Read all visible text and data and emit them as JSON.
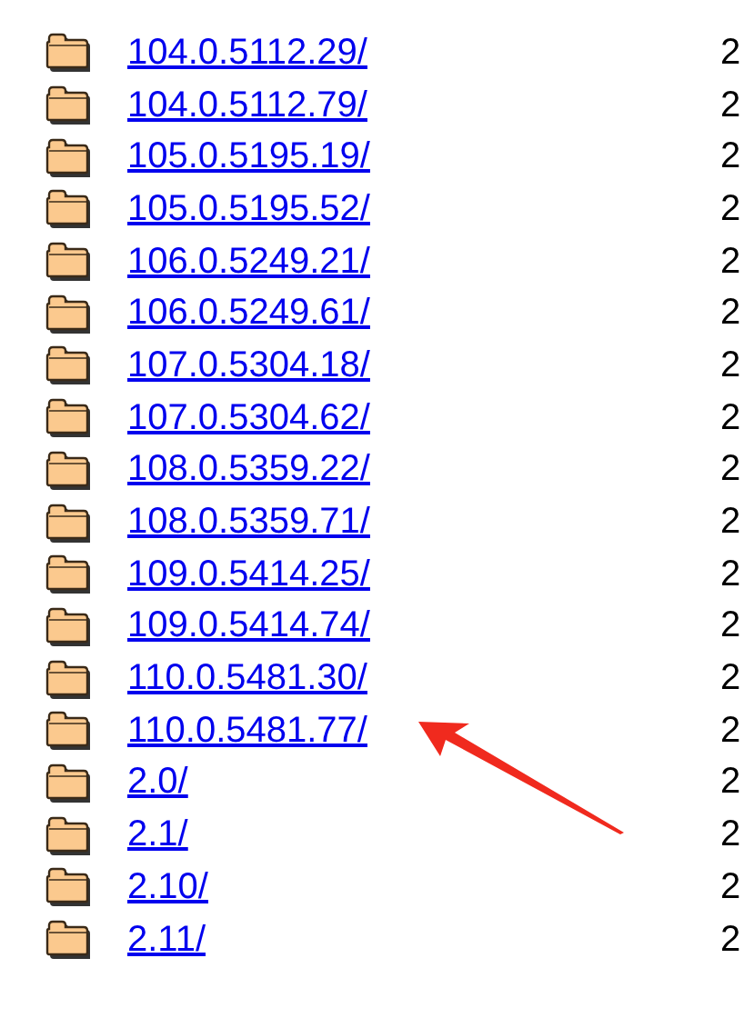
{
  "rows": [
    {
      "name": "104.0.5112.29/",
      "date": "2",
      "pointed": false
    },
    {
      "name": "104.0.5112.79/",
      "date": "2",
      "pointed": false
    },
    {
      "name": "105.0.5195.19/",
      "date": "2",
      "pointed": false
    },
    {
      "name": "105.0.5195.52/",
      "date": "2",
      "pointed": false
    },
    {
      "name": "106.0.5249.21/",
      "date": "2",
      "pointed": false
    },
    {
      "name": "106.0.5249.61/",
      "date": "2",
      "pointed": false
    },
    {
      "name": "107.0.5304.18/",
      "date": "2",
      "pointed": false
    },
    {
      "name": "107.0.5304.62/",
      "date": "2",
      "pointed": false
    },
    {
      "name": "108.0.5359.22/",
      "date": "2",
      "pointed": false
    },
    {
      "name": "108.0.5359.71/",
      "date": "2",
      "pointed": false
    },
    {
      "name": "109.0.5414.25/",
      "date": "2",
      "pointed": false
    },
    {
      "name": "109.0.5414.74/",
      "date": "2",
      "pointed": false
    },
    {
      "name": "110.0.5481.30/",
      "date": "2",
      "pointed": false
    },
    {
      "name": "110.0.5481.77/",
      "date": "2",
      "pointed": true
    },
    {
      "name": "2.0/",
      "date": "2",
      "pointed": false
    },
    {
      "name": "2.1/",
      "date": "2",
      "pointed": false
    },
    {
      "name": "2.10/",
      "date": "2",
      "pointed": false
    },
    {
      "name": "2.11/",
      "date": "2",
      "pointed": false
    }
  ]
}
